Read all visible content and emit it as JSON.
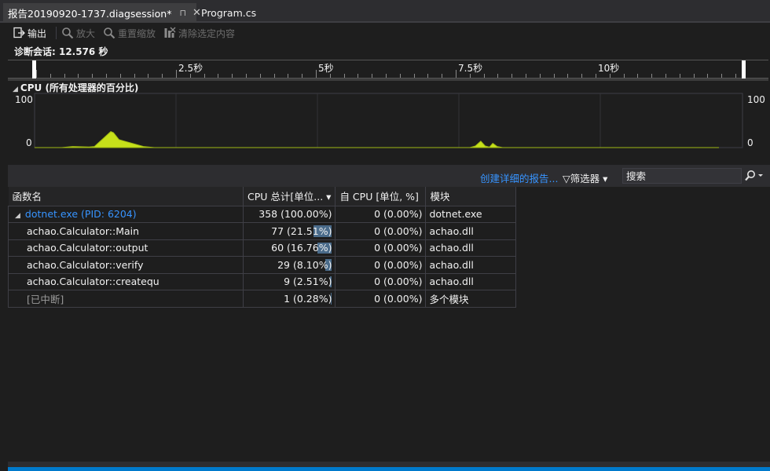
{
  "tabs": [
    {
      "label": "报告20190920-1737.diagsession*",
      "active": true
    },
    {
      "label": "Program.cs",
      "active": false
    }
  ],
  "tab_glyphs": {
    "pin": "⊓",
    "close": "✕"
  },
  "toolbar": {
    "export_label": "输出",
    "zoom_label": "放大",
    "reset_zoom_label": "重置缩放",
    "clear_selection_label": "清除选定内容"
  },
  "session": {
    "label": "诊断会话: 12.576 秒"
  },
  "ruler": {
    "labels": [
      "2.5秒",
      "5秒",
      "7.5秒",
      "10秒"
    ]
  },
  "cpu": {
    "title": "CPU (所有处理器的百分比)",
    "y_max_label": "100",
    "y_min_label": "0",
    "color": "#c6e01a"
  },
  "chart_data": {
    "type": "area",
    "title": "CPU (所有处理器的百分比)",
    "ylim": [
      0,
      100
    ],
    "xlim": [
      0,
      12.576
    ],
    "x": [
      0,
      0.5,
      0.7,
      1.0,
      1.1,
      1.4,
      1.45,
      1.55,
      1.65,
      2.0,
      2.2,
      4.0,
      6.0,
      8.0,
      8.1,
      8.2,
      8.28,
      8.36,
      8.42,
      8.5,
      8.6,
      10,
      12.576
    ],
    "values": [
      0,
      0,
      2,
      1,
      2,
      30,
      28,
      15,
      12,
      2,
      0,
      0,
      0,
      0,
      3,
      12,
      3,
      1,
      8,
      2,
      0,
      0,
      0
    ]
  },
  "filterbar": {
    "create_report_link": "创建详细的报告...",
    "filter_label": "筛选器",
    "search_placeholder": "搜索"
  },
  "table": {
    "columns": [
      "函数名",
      "CPU 总计[单位...",
      "自 CPU [单位, %]",
      "模块"
    ],
    "rows": [
      {
        "name": "dotnet.exe (PID: 6204)",
        "cpu_total": "358 (100.00%)",
        "self_cpu": "0 (0.00%)",
        "module": "dotnet.exe",
        "pct": 100
      },
      {
        "name": "achao.Calculator::Main",
        "cpu_total": "77 (21.51%)",
        "self_cpu": "0 (0.00%)",
        "module": "achao.dll",
        "pct": 21.51
      },
      {
        "name": "achao.Calculator::output",
        "cpu_total": "60 (16.76%)",
        "self_cpu": "0 (0.00%)",
        "module": "achao.dll",
        "pct": 16.76
      },
      {
        "name": "achao.Calculator::verify",
        "cpu_total": "29 (8.10%)",
        "self_cpu": "0 (0.00%)",
        "module": "achao.dll",
        "pct": 8.1
      },
      {
        "name": "achao.Calculator::createqu",
        "cpu_total": "9 (2.51%)",
        "self_cpu": "0 (0.00%)",
        "module": "achao.dll",
        "pct": 2.51
      },
      {
        "name": "[已中断]",
        "cpu_total": "1 (0.28%)",
        "self_cpu": "0 (0.00%)",
        "module": "多个模块",
        "pct": 0.28
      }
    ]
  }
}
